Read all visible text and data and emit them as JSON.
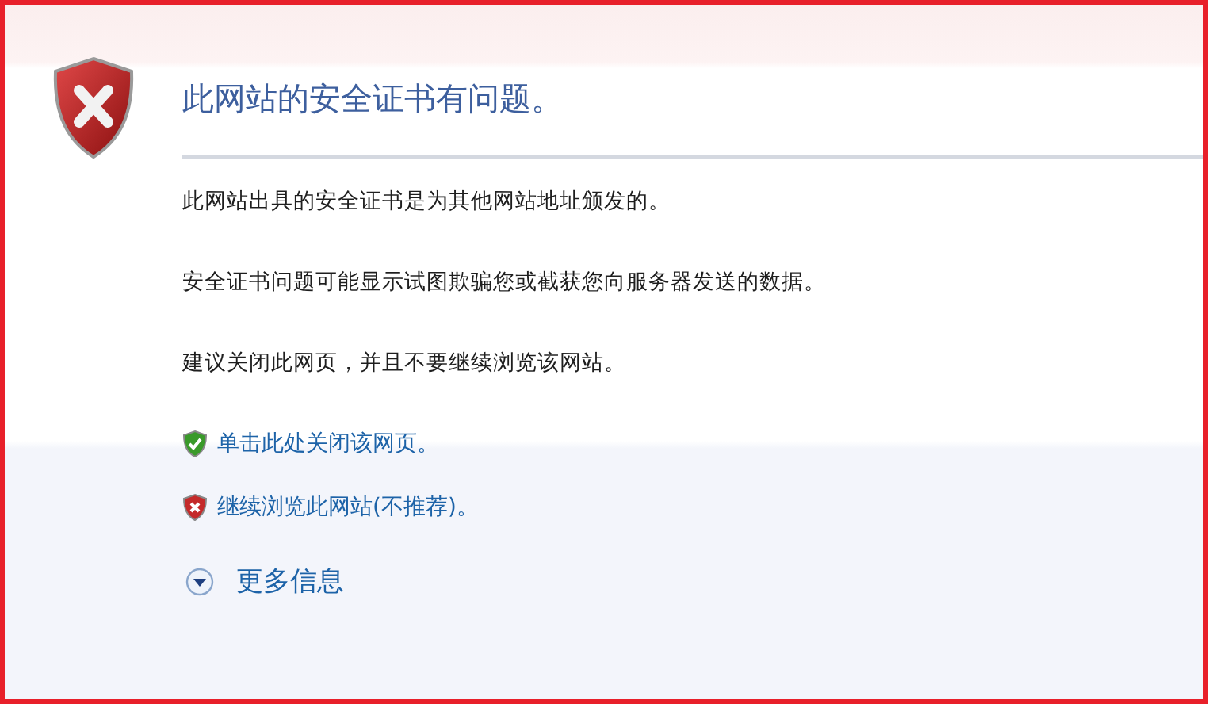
{
  "title": "此网站的安全证书有问题。",
  "paragraphs": [
    "此网站出具的安全证书是为其他网站地址颁发的。",
    "安全证书问题可能显示试图欺骗您或截获您向服务器发送的数据。",
    "建议关闭此网页，并且不要继续浏览该网站。"
  ],
  "links": [
    {
      "kind": "safe",
      "label": "单击此处关闭该网页。"
    },
    {
      "kind": "unsafe",
      "label": "继续浏览此网站(不推荐)。"
    }
  ],
  "more_info": {
    "label": "更多信息",
    "expanded": false
  }
}
